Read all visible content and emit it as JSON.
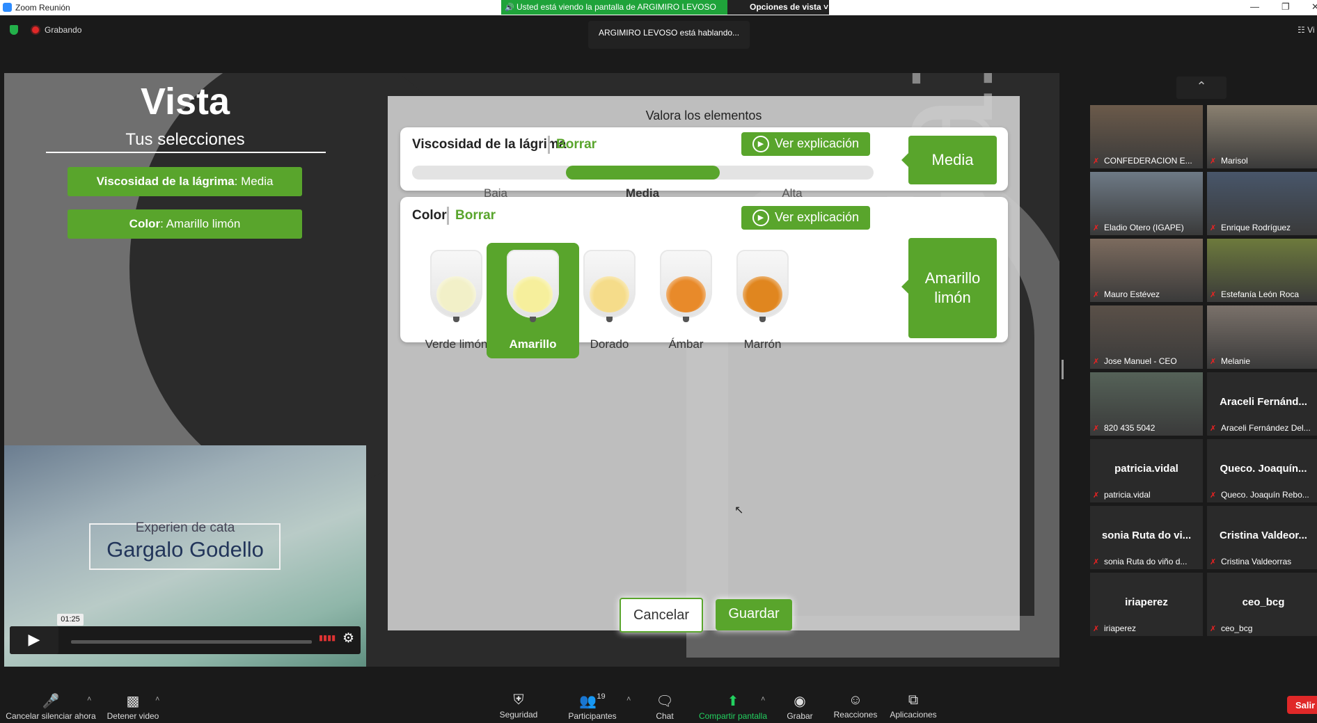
{
  "window": {
    "title": "Zoom Reunión",
    "share_banner": "Usted está viendo la pantalla de ARGIMIRO LEVOSO",
    "view_options": "Opciones de vista"
  },
  "status": {
    "recording": "Grabando",
    "talking": "ARGIMIRO LEVOSO está hablando..."
  },
  "left_panel": {
    "title": "Vista",
    "subtitle": "Tus selecciones",
    "selections": [
      {
        "label": "Viscosidad de la lágrima",
        "value": ": Media"
      },
      {
        "label": "Color",
        "value": ": Amarillo limón"
      }
    ]
  },
  "video": {
    "line1": "Experien    de cata",
    "line2": "Gargalo Godello",
    "time": "01:25"
  },
  "dialog": {
    "heading": "Valora los elementos",
    "viscosity": {
      "title": "Viscosidad de la lágrima",
      "clear": "Borrar",
      "explain": "Ver explicación",
      "levels": [
        "Baja",
        "Media",
        "Alta"
      ],
      "selected_index": 1,
      "result": "Media"
    },
    "color": {
      "title": "Color",
      "clear": "Borrar",
      "explain": "Ver explicación",
      "options": [
        {
          "label": "Verde limón",
          "wine": "#f2f0c8"
        },
        {
          "label": "Amarillo",
          "wine": "#f6ef9c"
        },
        {
          "label": "Dorado",
          "wine": "#f5dc8a"
        },
        {
          "label": "Ámbar",
          "wine": "#e88a2a"
        },
        {
          "label": "Marrón",
          "wine": "#e0861f"
        }
      ],
      "selected_index": 1,
      "result": "Amarillo limón"
    },
    "cancel": "Cancelar",
    "save": "Guardar"
  },
  "participants": [
    {
      "name": "CONFEDERACION E...",
      "video": true
    },
    {
      "name": "Marisol",
      "video": true
    },
    {
      "name": "Eladio Otero (IGAPE)",
      "video": true
    },
    {
      "name": "Enrique Rodríguez",
      "video": true
    },
    {
      "name": "Mauro Estévez",
      "video": true
    },
    {
      "name": "Estefanía León Roca",
      "video": true
    },
    {
      "name": "Jose Manuel - CEO",
      "video": true
    },
    {
      "name": "Melanie",
      "video": true
    },
    {
      "name": "820 435 5042",
      "video": true,
      "big": ""
    },
    {
      "name": "Araceli Fernández Del...",
      "big": "Araceli  Fernánd..."
    },
    {
      "name": "patricia.vidal",
      "big": "patricia.vidal"
    },
    {
      "name": "Queco. Joaquín Rebo...",
      "big": "Queco.  Joaquín..."
    },
    {
      "name": "sonia Ruta do viño d...",
      "big": "sonia Ruta do vi..."
    },
    {
      "name": "Cristina Valdeorras",
      "big": "Cristina  Valdeor..."
    },
    {
      "name": "iriaperez",
      "big": "iriaperez"
    },
    {
      "name": "ceo_bcg",
      "big": "ceo_bcg"
    }
  ],
  "toolbar": {
    "unmute": "Cancelar silenciar ahora",
    "video": "Detener video",
    "security": "Seguridad",
    "participants": "Participantes",
    "participants_count": "19",
    "chat": "Chat",
    "share": "Compartir pantalla",
    "record": "Grabar",
    "reactions": "Reacciones",
    "apps": "Aplicaciones",
    "exit": "Salir"
  },
  "accent": "#59a52c"
}
